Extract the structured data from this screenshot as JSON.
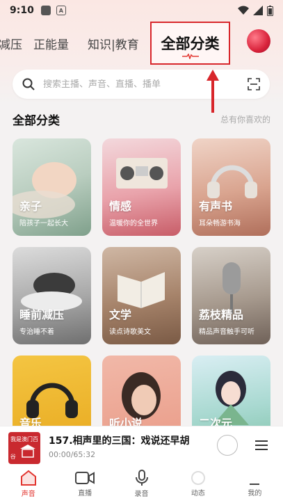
{
  "status": {
    "time": "9:10"
  },
  "tabs": {
    "items": [
      "减压",
      "正能量",
      "知识|教育"
    ],
    "active": "全部分类"
  },
  "search": {
    "placeholder": "搜索主播、声音、直播、播单"
  },
  "section": {
    "title": "全部分类",
    "subtitle": "总有你喜欢的"
  },
  "categories": [
    {
      "title": "亲子",
      "desc": "陪孩子一起长大"
    },
    {
      "title": "情感",
      "desc": "温暖你的全世界"
    },
    {
      "title": "有声书",
      "desc": "耳朵畅游书海"
    },
    {
      "title": "睡前减压",
      "desc": "专治睡不着"
    },
    {
      "title": "文学",
      "desc": "读点诗歌美文"
    },
    {
      "title": "荔枝精品",
      "desc": "精品声音触手可听"
    },
    {
      "title": "音乐",
      "desc": ""
    },
    {
      "title": "听小说",
      "desc": ""
    },
    {
      "title": "二次元",
      "desc": ""
    }
  ],
  "player": {
    "title": "157.相声里的三国：戏说还早胡",
    "time": "00:00/65:32",
    "cover_text": "我是澳门百谷"
  },
  "nav": [
    "声音",
    "直播",
    "录音",
    "动态",
    "我的"
  ],
  "colors": {
    "accent": "#e2352f",
    "highlight_box": "#d8262b"
  }
}
